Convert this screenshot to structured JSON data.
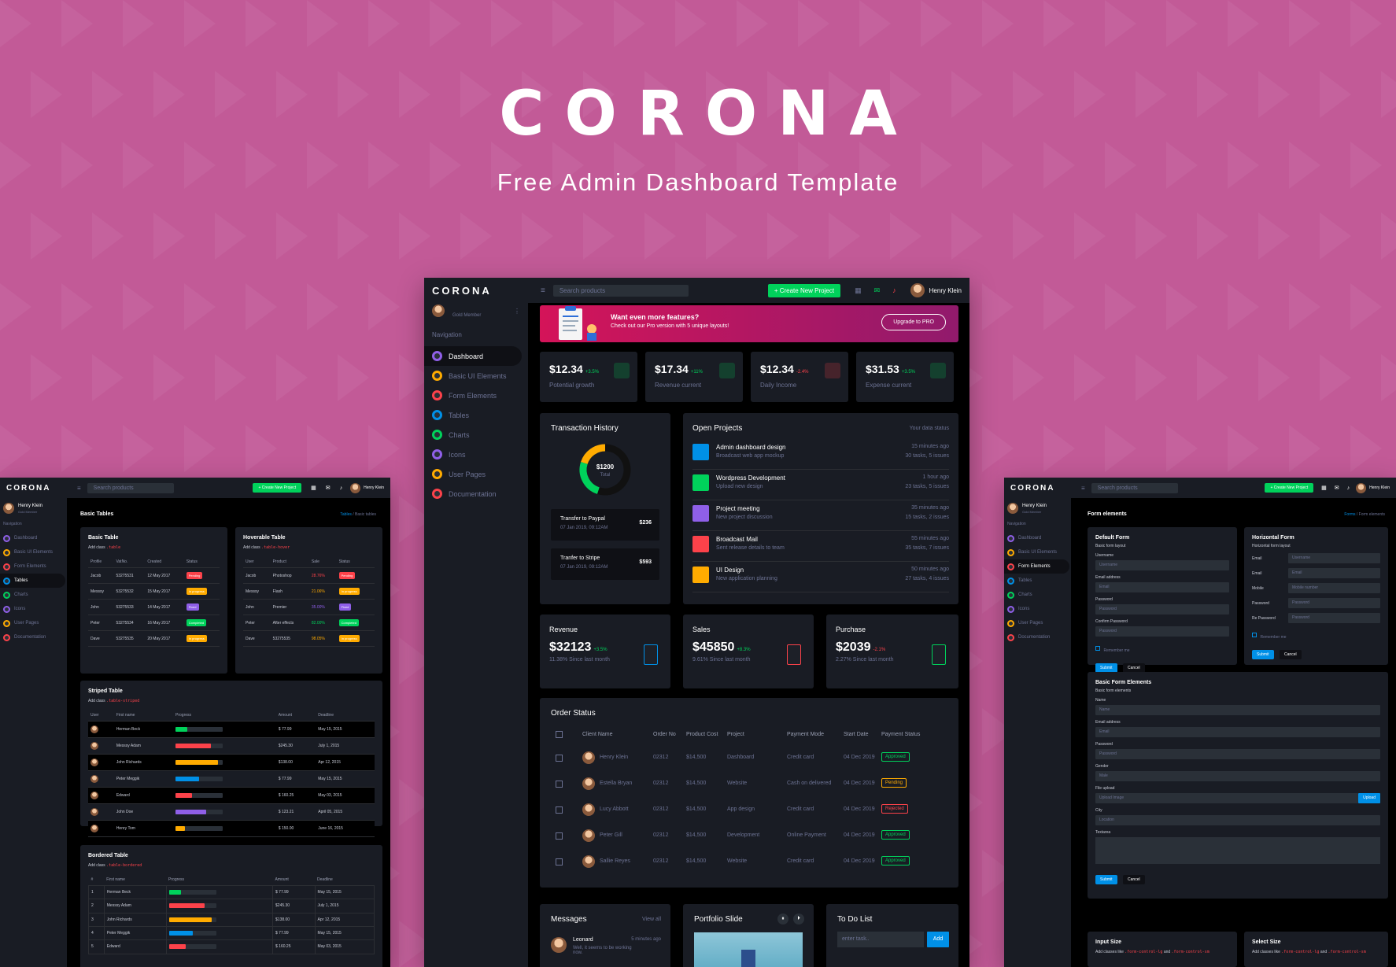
{
  "hero": {
    "title": "CORONA",
    "subtitle": "Free Admin Dashboard Template"
  },
  "colors": {
    "background": "#c25a97",
    "panel": "#191c24",
    "page": "#000000",
    "success": "#00d25b",
    "warning": "#ffab00",
    "danger": "#fc424a",
    "primary": "#0090e7",
    "purple": "#8f5fe8"
  },
  "topbar": {
    "logo": "CORONA",
    "search_placeholder": "Search products",
    "create_button": "+ Create New Project",
    "user_name": "Henry Klein"
  },
  "center": {
    "profile_role": "Gold Member",
    "nav_heading": "Navigation",
    "nav": [
      {
        "label": "Dashboard",
        "icon": "speedometer-icon",
        "color": "#8f5fe8"
      },
      {
        "label": "Basic UI Elements",
        "icon": "laptop-icon",
        "color": "#ffab00"
      },
      {
        "label": "Form Elements",
        "icon": "playlist-icon",
        "color": "#fc424a"
      },
      {
        "label": "Tables",
        "icon": "table-icon",
        "color": "#0090e7"
      },
      {
        "label": "Charts",
        "icon": "chart-icon",
        "color": "#00d25b"
      },
      {
        "label": "Icons",
        "icon": "contacts-icon",
        "color": "#8f5fe8"
      },
      {
        "label": "User Pages",
        "icon": "security-icon",
        "color": "#ffab00"
      },
      {
        "label": "Documentation",
        "icon": "document-icon",
        "color": "#fc424a"
      }
    ],
    "promo": {
      "title": "Want even more features?",
      "subtitle": "Check out our Pro version with 5 unique layouts!",
      "button": "Upgrade to PRO"
    },
    "stats": [
      {
        "value": "$12.34",
        "change": "+3.5%",
        "label": "Potential growth",
        "trend": "up"
      },
      {
        "value": "$17.34",
        "change": "+11%",
        "label": "Revenue current",
        "trend": "up"
      },
      {
        "value": "$12.34",
        "change": "-2.4%",
        "label": "Daily Income",
        "trend": "down"
      },
      {
        "value": "$31.53",
        "change": "+3.5%",
        "label": "Expense current",
        "trend": "up"
      }
    ],
    "transaction_history": {
      "title": "Transaction History",
      "donut_value": "$1200",
      "donut_label": "Total",
      "donut_share": [
        0.55,
        0.25,
        0.2
      ],
      "items": [
        {
          "title": "Transfer to Paypal",
          "date": "07 Jan 2019, 09:12AM",
          "amount": "$236"
        },
        {
          "title": "Tranfer to Stripe",
          "date": "07 Jan 2019, 09:12AM",
          "amount": "$593"
        }
      ]
    },
    "open_projects": {
      "title": "Open Projects",
      "subtitle": "Your data status",
      "items": [
        {
          "title": "Admin dashboard design",
          "desc": "Broadcast web app mockup",
          "time": "15 minutes ago",
          "tasks": "30 tasks, 5 issues",
          "color": "#0090e7"
        },
        {
          "title": "Wordpress Development",
          "desc": "Upload new design",
          "time": "1 hour ago",
          "tasks": "23 tasks, 5 issues",
          "color": "#00d25b"
        },
        {
          "title": "Project meeting",
          "desc": "New project discussion",
          "time": "35 minutes ago",
          "tasks": "15 tasks, 2 issues",
          "color": "#8f5fe8"
        },
        {
          "title": "Broadcast Mail",
          "desc": "Sent release details to team",
          "time": "55 minutes ago",
          "tasks": "35 tasks, 7 issues",
          "color": "#fc424a"
        },
        {
          "title": "UI Design",
          "desc": "New application planning",
          "time": "50 minutes ago",
          "tasks": "27 tasks, 4 issues",
          "color": "#ffab00"
        }
      ]
    },
    "summary": [
      {
        "title": "Revenue",
        "value": "$32123",
        "change": "+3.5%",
        "note": "11.38% Since last month",
        "color": "#0090e7"
      },
      {
        "title": "Sales",
        "value": "$45850",
        "change": "+8.3%",
        "note": "9.61% Since last month",
        "color": "#fc424a"
      },
      {
        "title": "Purchase",
        "value": "$2039",
        "change": "-2.1%",
        "note": "2.27% Since last month",
        "color": "#00d25b"
      }
    ],
    "order_status": {
      "title": "Order Status",
      "columns": [
        "Client Name",
        "Order No",
        "Product Cost",
        "Project",
        "Payment Mode",
        "Start Date",
        "Payment Status"
      ],
      "rows": [
        {
          "name": "Henry Klein",
          "order": "02312",
          "cost": "$14,500",
          "project": "Dashboard",
          "mode": "Credit card",
          "date": "04 Dec 2019",
          "status": "Approved",
          "status_color": "#00d25b"
        },
        {
          "name": "Estella Bryan",
          "order": "02312",
          "cost": "$14,500",
          "project": "Website",
          "mode": "Cash on delivered",
          "date": "04 Dec 2019",
          "status": "Pending",
          "status_color": "#ffab00"
        },
        {
          "name": "Lucy Abbott",
          "order": "02312",
          "cost": "$14,500",
          "project": "App design",
          "mode": "Credit card",
          "date": "04 Dec 2019",
          "status": "Rejected",
          "status_color": "#fc424a"
        },
        {
          "name": "Peter Gill",
          "order": "02312",
          "cost": "$14,500",
          "project": "Development",
          "mode": "Online Payment",
          "date": "04 Dec 2019",
          "status": "Approved",
          "status_color": "#00d25b"
        },
        {
          "name": "Sallie Reyes",
          "order": "02312",
          "cost": "$14,500",
          "project": "Website",
          "mode": "Credit card",
          "date": "04 Dec 2019",
          "status": "Approved",
          "status_color": "#00d25b"
        }
      ]
    },
    "messages": {
      "title": "Messages",
      "view_all": "View all",
      "name": "Leonard",
      "time": "5 minutes ago",
      "text": "Well, it seems to be working now."
    },
    "portfolio": {
      "title": "Portfolio Slide"
    },
    "todo": {
      "title": "To Do List",
      "placeholder": "enter task..",
      "button": "Add"
    }
  },
  "left": {
    "user_name": "Henry Klein",
    "user_role": "Gold Member",
    "nav_heading": "Navigation",
    "nav": [
      "Dashboard",
      "Basic UI Elements",
      "Form Elements",
      "Tables",
      "Charts",
      "Icons",
      "User Pages",
      "Documentation"
    ],
    "page_title": "Basic Tables",
    "breadcrumb_parent": "Tables",
    "breadcrumb_current": "Basic tables",
    "basic_table": {
      "title": "Basic Table",
      "hint": "Add class",
      "code": ".table",
      "columns": [
        "Profile",
        "VatNo.",
        "Created",
        "Status"
      ],
      "rows": [
        [
          "Jacob",
          "53275531",
          "12 May 2017",
          "Pending",
          "#fc424a"
        ],
        [
          "Messsy",
          "53275532",
          "15 May 2017",
          "In progress",
          "#ffab00"
        ],
        [
          "John",
          "53275533",
          "14 May 2017",
          "Fixed",
          "#8f5fe8"
        ],
        [
          "Peter",
          "53275534",
          "16 May 2017",
          "Completed",
          "#00d25b"
        ],
        [
          "Dave",
          "53275535",
          "20 May 2017",
          "In progress",
          "#ffab00"
        ]
      ]
    },
    "hover_table": {
      "title": "Hoverable Table",
      "hint": "Add class",
      "code": ".table-hover",
      "columns": [
        "User",
        "Product",
        "Sale",
        "Status"
      ],
      "rows": [
        [
          "Jacob",
          "Photoshop",
          "28.76%",
          "Pending",
          "#fc424a"
        ],
        [
          "Messsy",
          "Flash",
          "21.06%",
          "In progress",
          "#ffab00"
        ],
        [
          "John",
          "Premier",
          "35.00%",
          "Fixed",
          "#8f5fe8"
        ],
        [
          "Peter",
          "After effects",
          "82.00%",
          "Completed",
          "#00d25b"
        ],
        [
          "Dave",
          "53275535",
          "98.05%",
          "In progress",
          "#ffab00"
        ]
      ]
    },
    "striped_table": {
      "title": "Striped Table",
      "hint": "Add class",
      "code": ".table-striped",
      "columns": [
        "User",
        "First name",
        "Progress",
        "Amount",
        "Deadline"
      ],
      "rows": [
        [
          "Herman Beck",
          0.25,
          "#00d25b",
          "$ 77.99",
          "May 15, 2015"
        ],
        [
          "Messsy Adam",
          0.75,
          "#fc424a",
          "$245.30",
          "July 1, 2015"
        ],
        [
          "John Richards",
          0.9,
          "#ffab00",
          "$138.00",
          "Apr 12, 2015"
        ],
        [
          "Peter Meggik",
          0.5,
          "#0090e7",
          "$ 77.99",
          "May 15, 2015"
        ],
        [
          "Edward",
          0.35,
          "#fc424a",
          "$ 160.25",
          "May 03, 2015"
        ],
        [
          "John Doe",
          0.65,
          "#8f5fe8",
          "$ 123.21",
          "April 05, 2015"
        ],
        [
          "Henry Tom",
          0.2,
          "#ffab00",
          "$ 150.00",
          "June 16, 2015"
        ]
      ]
    },
    "bordered_table": {
      "title": "Bordered Table",
      "hint": "Add class",
      "code": ".table-bordered",
      "columns": [
        "#",
        "First name",
        "Progress",
        "Amount",
        "Deadline"
      ],
      "rows": [
        [
          "1",
          "Herman Beck",
          0.25,
          "#00d25b",
          "$ 77.99",
          "May 15, 2015"
        ],
        [
          "2",
          "Messsy Adam",
          0.75,
          "#fc424a",
          "$245.30",
          "July 1, 2015"
        ],
        [
          "3",
          "John Richards",
          0.9,
          "#ffab00",
          "$138.00",
          "Apr 12, 2015"
        ],
        [
          "4",
          "Peter Meggik",
          0.5,
          "#0090e7",
          "$ 77.99",
          "May 15, 2015"
        ],
        [
          "5",
          "Edward",
          0.35,
          "#fc424a",
          "$ 160.25",
          "May 03, 2015"
        ]
      ]
    }
  },
  "right": {
    "page_title": "Form elements",
    "breadcrumb_parent": "Forms",
    "breadcrumb_current": "Form elements",
    "default_form": {
      "title": "Default Form",
      "subtitle": "Basic form layout",
      "fields": [
        {
          "label": "Username",
          "placeholder": "Username"
        },
        {
          "label": "Email address",
          "placeholder": "Email"
        },
        {
          "label": "Password",
          "placeholder": "Password"
        },
        {
          "label": "Confirm Password",
          "placeholder": "Password"
        }
      ],
      "remember": "Remember me",
      "submit": "Submit",
      "cancel": "Cancel"
    },
    "horizontal_form": {
      "title": "Horizontal Form",
      "subtitle": "Horizontal form layout",
      "fields": [
        {
          "label": "Email",
          "placeholder": "Username"
        },
        {
          "label": "Email",
          "placeholder": "Email"
        },
        {
          "label": "Mobile",
          "placeholder": "Mobile number"
        },
        {
          "label": "Password",
          "placeholder": "Password"
        },
        {
          "label": "Re Password",
          "placeholder": "Password"
        }
      ],
      "remember": "Remember me",
      "submit": "Submit",
      "cancel": "Cancel"
    },
    "basic_elements": {
      "title": "Basic Form Elements",
      "subtitle": "Basic form elements",
      "fields": [
        {
          "label": "Name",
          "placeholder": "Name"
        },
        {
          "label": "Email address",
          "placeholder": "Email"
        },
        {
          "label": "Password",
          "placeholder": "Password"
        },
        {
          "label": "Gender",
          "placeholder": "Male"
        },
        {
          "label": "File upload",
          "placeholder": "Upload Image"
        },
        {
          "label": "City",
          "placeholder": "Location"
        }
      ],
      "upload": "Upload",
      "textarea_label": "Textarea",
      "submit": "Submit",
      "cancel": "Cancel"
    },
    "input_size": {
      "title": "Input Size",
      "text": "Add classes like",
      "code1": ".form-control-lg",
      "and": "and",
      "code2": ".form-control-sm"
    },
    "select_size": {
      "title": "Select Size",
      "text": "Add classes like",
      "code1": ".form-control-lg",
      "and": "and",
      "code2": ".form-control-sm"
    }
  }
}
